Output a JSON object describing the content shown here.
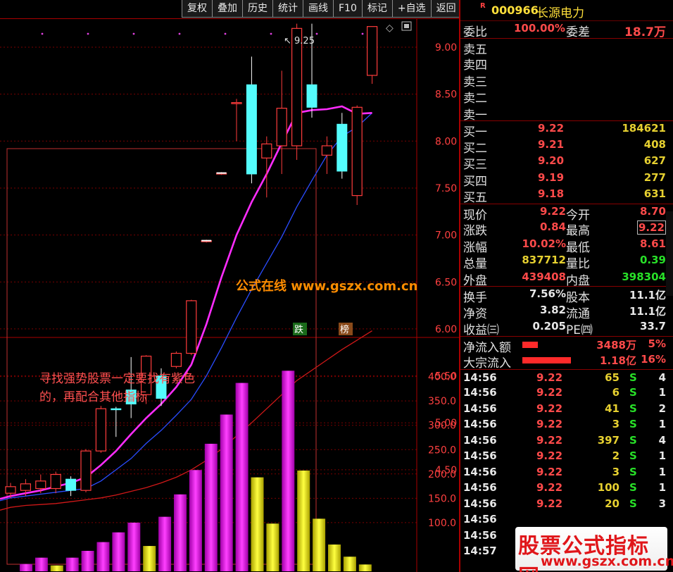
{
  "toolbar": {
    "buttons": [
      "复权",
      "叠加",
      "历史",
      "统计",
      "画线",
      "F10",
      "标记",
      "+自选",
      "返回"
    ]
  },
  "chart": {
    "price_axis": [
      "9.00",
      "8.50",
      "8.00",
      "7.50",
      "7.00",
      "6.50",
      "6.00",
      "5.50",
      "5.00",
      "4.50"
    ],
    "volume_axis": [
      "400.0",
      "350.0",
      "300.0",
      "250.0",
      "200.0",
      "150.0",
      "100.0"
    ],
    "high_label": "9.25",
    "tag_fall": "跌",
    "tag_rank": "榜",
    "watermark": "公式在线 www.gszx.com.cn",
    "note_line1": "寻找强势股票一定要找有紫色",
    "note_line2": "的，再配合其他指标",
    "colors": {
      "up": "#ff3c3c",
      "down": "#54fcfc",
      "ma5": "#ff2cff",
      "ma10": "#2a4cff",
      "ma20": "#d01818",
      "vol_purple": "#e800e8",
      "vol_yellow": "#e0e000"
    }
  },
  "stock": {
    "marker": "R",
    "code": "000966",
    "name": "长源电力"
  },
  "quote": {
    "weibi_label": "委比",
    "weibi_value": "100.00%",
    "weicha_label": "委差",
    "weicha_value": "18.7万",
    "sell": [
      {
        "label": "卖五"
      },
      {
        "label": "卖四"
      },
      {
        "label": "卖三"
      },
      {
        "label": "卖二"
      },
      {
        "label": "卖一"
      }
    ],
    "buy": [
      {
        "label": "买一",
        "price": "9.22",
        "vol": "184621"
      },
      {
        "label": "买二",
        "price": "9.21",
        "vol": "408"
      },
      {
        "label": "买三",
        "price": "9.20",
        "vol": "627"
      },
      {
        "label": "买四",
        "price": "9.19",
        "vol": "277"
      },
      {
        "label": "买五",
        "price": "9.18",
        "vol": "631"
      }
    ],
    "stats": [
      {
        "l1": "现价",
        "v1": "9.22",
        "l2": "今开",
        "v2": "8.70"
      },
      {
        "l1": "涨跌",
        "v1": "0.84",
        "l2": "最高",
        "v2": "9.22"
      },
      {
        "l1": "涨幅",
        "v1": "10.02%",
        "l2": "最低",
        "v2": "8.61"
      },
      {
        "l1": "总量",
        "v1": "837712",
        "l2": "量比",
        "v2": "0.39"
      },
      {
        "l1": "外盘",
        "v1": "439408",
        "l2": "内盘",
        "v2": "398304"
      }
    ],
    "fund": [
      {
        "l1": "换手",
        "v1": "7.56%",
        "l2": "股本",
        "v2": "11.1亿"
      },
      {
        "l1": "净资",
        "v1": "3.82",
        "l2": "流通",
        "v2": "11.1亿"
      },
      {
        "l1": "收益㈢",
        "v1": "0.205",
        "l2": "PE㈣",
        "v2": "33.7"
      }
    ],
    "flow": [
      {
        "label": "净流入额",
        "value": "3488万",
        "pct": "5%",
        "bar": 0.05
      },
      {
        "label": "大宗流入",
        "value": "1.18亿",
        "pct": "16%",
        "bar": 0.16
      }
    ]
  },
  "ticks": [
    {
      "time": "14:56",
      "price": "9.22",
      "vol": "65",
      "side": "S",
      "n": "4"
    },
    {
      "time": "14:56",
      "price": "9.22",
      "vol": "6",
      "side": "S",
      "n": "1"
    },
    {
      "time": "14:56",
      "price": "9.22",
      "vol": "41",
      "side": "S",
      "n": "2"
    },
    {
      "time": "14:56",
      "price": "9.22",
      "vol": "3",
      "side": "S",
      "n": "1"
    },
    {
      "time": "14:56",
      "price": "9.22",
      "vol": "397",
      "side": "S",
      "n": "4"
    },
    {
      "time": "14:56",
      "price": "9.22",
      "vol": "2",
      "side": "S",
      "n": "1"
    },
    {
      "time": "14:56",
      "price": "9.22",
      "vol": "3",
      "side": "S",
      "n": "1"
    },
    {
      "time": "14:56",
      "price": "9.22",
      "vol": "100",
      "side": "S",
      "n": "1"
    },
    {
      "time": "14:56",
      "price": "9.22",
      "vol": "20",
      "side": "S",
      "n": "3"
    },
    {
      "time": "14:56",
      "price": "",
      "vol": "",
      "side": "",
      "n": ""
    },
    {
      "time": "14:56",
      "price": "",
      "vol": "",
      "side": "",
      "n": ""
    },
    {
      "time": "14:57",
      "price": "",
      "vol": "",
      "side": "",
      "n": ""
    }
  ],
  "corner_watermark": {
    "line1": "股票公式指标网",
    "line2": "www.gszx.com.cn"
  },
  "candles": [
    {
      "o": 4.25,
      "c": 4.32,
      "h": 4.36,
      "l": 4.2
    },
    {
      "o": 4.28,
      "c": 4.35,
      "h": 4.4,
      "l": 4.22
    },
    {
      "o": 4.3,
      "c": 4.38,
      "h": 4.45,
      "l": 4.25
    },
    {
      "o": 4.3,
      "c": 4.45,
      "h": 4.48,
      "l": 4.25
    },
    {
      "o": 4.4,
      "c": 4.28,
      "h": 4.43,
      "l": 4.22
    },
    {
      "o": 4.28,
      "c": 4.7,
      "h": 4.72,
      "l": 4.26
    },
    {
      "o": 4.7,
      "c": 5.15,
      "h": 5.18,
      "l": 4.68
    },
    {
      "o": 5.15,
      "c": 5.14,
      "h": 5.17,
      "l": 4.85
    },
    {
      "o": 5.35,
      "c": 5.2,
      "h": 5.7,
      "l": 5.05
    },
    {
      "o": 5.3,
      "c": 5.71,
      "h": 5.72,
      "l": 5.2
    },
    {
      "o": 5.5,
      "c": 5.26,
      "h": 5.58,
      "l": 5.18
    },
    {
      "o": 5.6,
      "c": 5.74,
      "h": 5.76,
      "l": 5.58
    },
    {
      "o": 5.74,
      "c": 6.3,
      "h": 6.31,
      "l": 5.72
    },
    {
      "o": 6.93,
      "c": 6.94,
      "h": 6.95,
      "l": 6.92
    },
    {
      "o": 7.65,
      "c": 7.66,
      "h": 7.67,
      "l": 7.64
    },
    {
      "o": 8.4,
      "c": 8.41,
      "h": 8.45,
      "l": 8.0
    },
    {
      "o": 8.6,
      "c": 7.65,
      "h": 8.9,
      "l": 7.55
    },
    {
      "o": 7.82,
      "c": 7.97,
      "h": 8.05,
      "l": 7.4
    },
    {
      "o": 7.95,
      "c": 8.35,
      "h": 8.75,
      "l": 7.65
    },
    {
      "o": 7.95,
      "c": 9.2,
      "h": 9.25,
      "l": 7.8
    },
    {
      "o": 8.6,
      "c": 8.36,
      "h": 9.25,
      "l": 8.25
    },
    {
      "o": 7.85,
      "c": 7.95,
      "h": 8.05,
      "l": 7.65
    },
    {
      "o": 8.18,
      "c": 7.68,
      "h": 8.3,
      "l": 7.6
    },
    {
      "o": 7.42,
      "c": 8.36,
      "h": 8.38,
      "l": 7.32
    },
    {
      "o": 8.7,
      "c": 9.22,
      "h": 9.22,
      "l": 8.61
    }
  ],
  "ma5": [
    4.22,
    4.25,
    4.28,
    4.32,
    4.36,
    4.42,
    4.55,
    4.7,
    4.88,
    5.05,
    5.2,
    5.38,
    5.62,
    6.05,
    6.55,
    7.0,
    7.35,
    7.65,
    7.98,
    8.3,
    8.33,
    8.34,
    8.37,
    8.29,
    8.3
  ],
  "ma10": [
    4.2,
    4.22,
    4.24,
    4.26,
    4.28,
    4.3,
    4.38,
    4.5,
    4.62,
    4.78,
    4.92,
    5.08,
    5.25,
    5.5,
    5.8,
    6.12,
    6.42,
    6.7,
    6.98,
    7.3,
    7.58,
    7.85,
    8.05,
    8.15,
    8.3
  ],
  "ma20": [
    4.1,
    4.12,
    4.13,
    4.14,
    4.16,
    4.18,
    4.2,
    4.23,
    4.27,
    4.31,
    4.36,
    4.42,
    4.5,
    4.6,
    4.72,
    4.86,
    5.0,
    5.15,
    5.3,
    5.45,
    5.56,
    5.67,
    5.78,
    5.88,
    5.98
  ],
  "volumes": [
    {
      "v": 15,
      "t": "p"
    },
    {
      "v": 28,
      "t": "p"
    },
    {
      "v": 12,
      "t": "y"
    },
    {
      "v": 28,
      "t": "p"
    },
    {
      "v": 42,
      "t": "p"
    },
    {
      "v": 60,
      "t": "p"
    },
    {
      "v": 80,
      "t": "p"
    },
    {
      "v": 100,
      "t": "p"
    },
    {
      "v": 52,
      "t": "y"
    },
    {
      "v": 112,
      "t": "p"
    },
    {
      "v": 158,
      "t": "p"
    },
    {
      "v": 208,
      "t": "p"
    },
    {
      "v": 262,
      "t": "p"
    },
    {
      "v": 322,
      "t": "p"
    },
    {
      "v": 387,
      "t": "p"
    },
    {
      "v": 193,
      "t": "y"
    },
    {
      "v": 98,
      "t": "y"
    },
    {
      "v": 412,
      "t": "p"
    },
    {
      "v": 207,
      "t": "y"
    },
    {
      "v": 108,
      "t": "y"
    },
    {
      "v": 55,
      "t": "y"
    },
    {
      "v": 30,
      "t": "y"
    },
    {
      "v": 14,
      "t": "y"
    }
  ]
}
